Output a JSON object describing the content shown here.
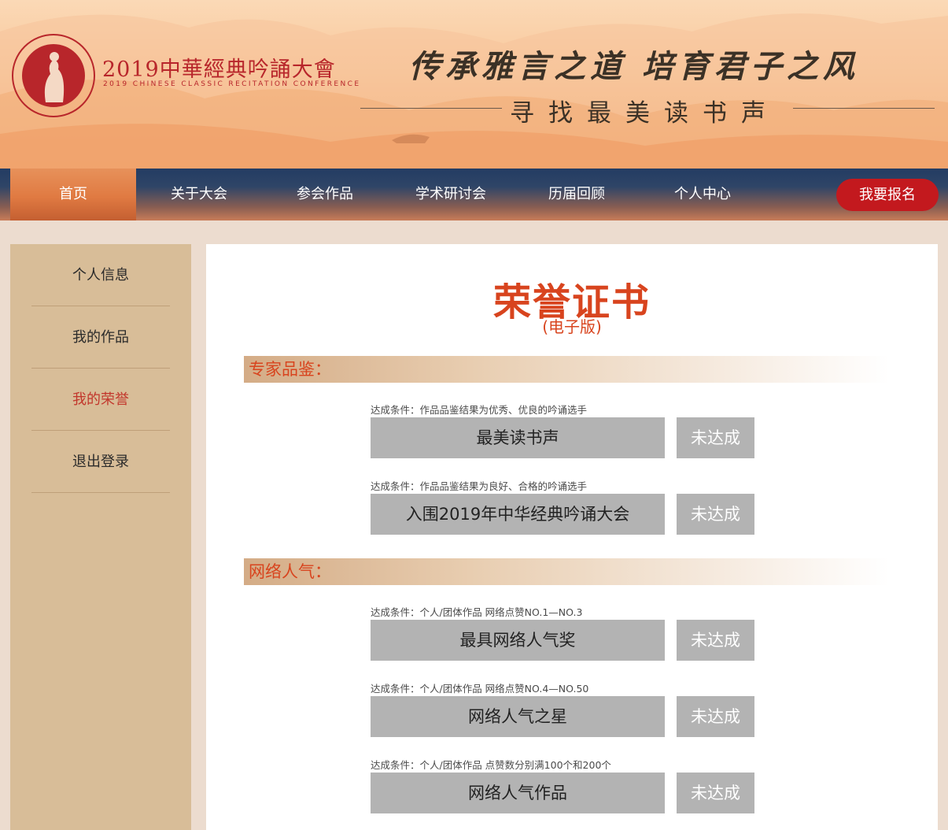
{
  "header": {
    "logo_title": "2019中華經典吟誦大會",
    "logo_subtitle": "2019 CHINESE CLASSIC RECITATION CONFERENCE",
    "slogan": "传承雅言之道 培育君子之风",
    "tagline": "寻找最美读书声"
  },
  "nav": {
    "items": [
      {
        "label": "首页"
      },
      {
        "label": "关于大会"
      },
      {
        "label": "参会作品"
      },
      {
        "label": "学术研讨会"
      },
      {
        "label": "历届回顾"
      },
      {
        "label": "个人中心"
      }
    ],
    "active_index": 0,
    "signup_label": "我要报名"
  },
  "sidebar": {
    "items": [
      {
        "label": "个人信息"
      },
      {
        "label": "我的作品"
      },
      {
        "label": "我的荣誉"
      },
      {
        "label": "退出登录"
      }
    ],
    "active_index": 2
  },
  "certificate": {
    "title": "荣誉证书",
    "subtitle": "(电子版)",
    "sections": [
      {
        "heading": "专家品鉴：",
        "awards": [
          {
            "condition": "达成条件：作品品鉴结果为优秀、优良的吟诵选手",
            "name": "最美读书声",
            "status": "未达成"
          },
          {
            "condition": "达成条件：作品品鉴结果为良好、合格的吟诵选手",
            "name": "入围2019年中华经典吟诵大会",
            "status": "未达成"
          }
        ]
      },
      {
        "heading": "网络人气：",
        "awards": [
          {
            "condition": "达成条件：个人/团体作品 网络点赞NO.1—NO.3",
            "name": "最具网络人气奖",
            "status": "未达成"
          },
          {
            "condition": "达成条件：个人/团体作品 网络点赞NO.4—NO.50",
            "name": "网络人气之星",
            "status": "未达成"
          },
          {
            "condition": "达成条件：个人/团体作品 点赞数分别满100个和200个",
            "name": "网络人气作品",
            "status": "未达成"
          }
        ]
      }
    ]
  },
  "colors": {
    "accent_red": "#c3191e",
    "title_orange": "#d8441e",
    "sidebar_bg": "#d8bd98",
    "status_gray": "#b3b3b3"
  }
}
